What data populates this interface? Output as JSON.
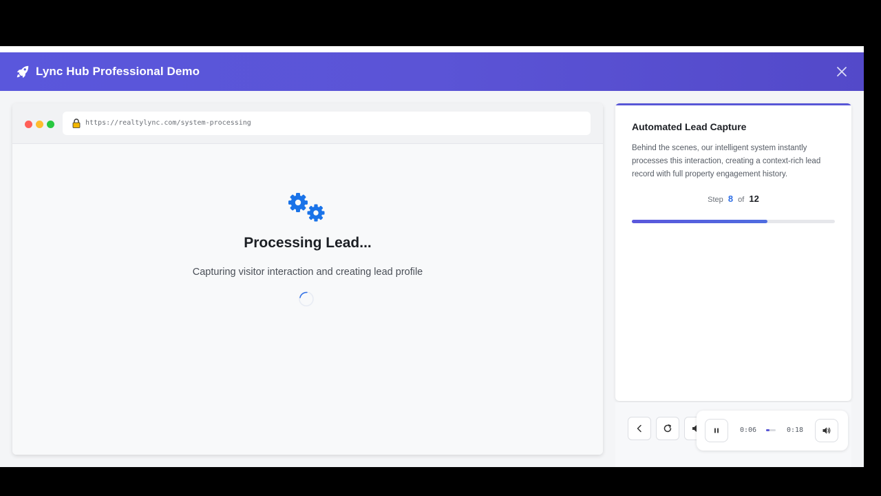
{
  "header": {
    "title": "Lync Hub Professional Demo",
    "rocket_icon": "rocket-icon",
    "close_icon": "close-icon"
  },
  "browser": {
    "url": "https://realtylync.com/system-processing",
    "lock_icon": "lock-icon",
    "content": {
      "icon": "gears-icon",
      "title": "Processing Lead...",
      "subtitle": "Capturing visitor interaction and creating lead profile"
    }
  },
  "panel": {
    "title": "Automated Lead Capture",
    "description": "Behind the scenes, our intelligent system instantly processes this interaction, creating a context-rich lead record with full property engagement history.",
    "step_label": "Step",
    "step_current": "8",
    "step_of": "of",
    "step_total": "12",
    "progress_fraction": 0.667
  },
  "controls": {
    "prev_icon": "chevron-left-icon",
    "restart_icon": "refresh-icon",
    "audio": {
      "pause_icon": "pause-icon",
      "current_time": "0:06",
      "duration": "0:18",
      "played_fraction": 0.333,
      "volume_icon": "volume-icon"
    }
  },
  "colors": {
    "header_start": "#5a57dc",
    "header_end": "#5349c9",
    "accent_blue": "#2f6fe6",
    "progress": "#5a57dc"
  }
}
